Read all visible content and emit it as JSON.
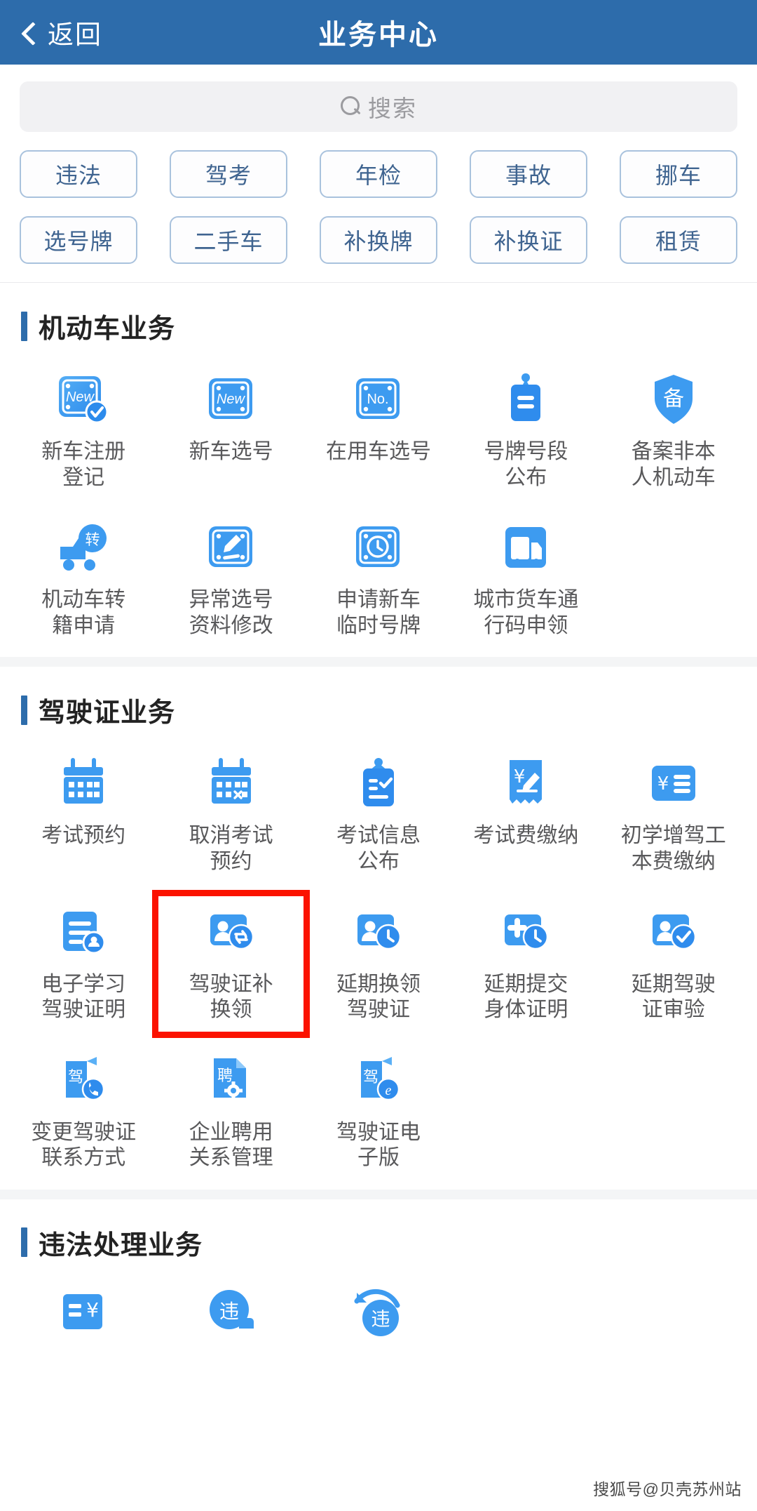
{
  "header": {
    "back_label": "返回",
    "title": "业务中心",
    "back_icon": "chevron-left-icon",
    "bg_color": "#2d6cab"
  },
  "search": {
    "placeholder": "搜索",
    "icon": "search-icon"
  },
  "quick_tags": {
    "row1": [
      "违法",
      "驾考",
      "年检",
      "事故",
      "挪车"
    ],
    "row2": [
      "选号牌",
      "二手车",
      "补换牌",
      "补换证",
      "租赁"
    ]
  },
  "sections": [
    {
      "title": "机动车业务",
      "items": [
        {
          "label": "新车注册\n登记",
          "icon": "plate-new-check-icon"
        },
        {
          "label": "新车选号",
          "icon": "plate-new-icon"
        },
        {
          "label": "在用车选号",
          "icon": "plate-no-icon"
        },
        {
          "label": "号牌号段\n公布",
          "icon": "tag-board-icon"
        },
        {
          "label": "备案非本\n人机动车",
          "icon": "shield-bei-icon"
        },
        {
          "label": "机动车转\n籍申请",
          "icon": "truck-zhuan-icon"
        },
        {
          "label": "异常选号\n资料修改",
          "icon": "plate-pencil-icon"
        },
        {
          "label": "申请新车\n临时号牌",
          "icon": "plate-clock-icon"
        },
        {
          "label": "城市货车通\n行码申领",
          "icon": "cargo-truck-icon"
        }
      ]
    },
    {
      "title": "驾驶证业务",
      "items": [
        {
          "label": "考试预约",
          "icon": "calendar-icon"
        },
        {
          "label": "取消考试\n预约",
          "icon": "calendar-cancel-icon"
        },
        {
          "label": "考试信息\n公布",
          "icon": "clipboard-check-icon"
        },
        {
          "label": "考试费缴纳",
          "icon": "receipt-yuan-pen-icon"
        },
        {
          "label": "初学增驾工\n本费缴纳",
          "icon": "yuan-list-icon"
        },
        {
          "label": "电子学习\n驾驶证明",
          "icon": "document-stamp-icon"
        },
        {
          "label": "驾驶证补\n换领",
          "icon": "id-refresh-icon",
          "highlighted": true
        },
        {
          "label": "延期换领\n驾驶证",
          "icon": "id-clock-icon"
        },
        {
          "label": "延期提交\n身体证明",
          "icon": "plus-clock-icon"
        },
        {
          "label": "延期驾驶\n证审验",
          "icon": "id-check-icon"
        },
        {
          "label": "变更驾驶证\n联系方式",
          "icon": "license-phone-icon"
        },
        {
          "label": "企业聘用\n关系管理",
          "icon": "pin-gear-icon"
        },
        {
          "label": "驾驶证电\n子版",
          "icon": "license-e-icon"
        }
      ]
    },
    {
      "title": "违法处理业务",
      "items": [
        {
          "label": "",
          "icon": "fine-yuan-icon"
        },
        {
          "label": "",
          "icon": "wei-balloon-icon"
        },
        {
          "label": "",
          "icon": "wei-arrow-icon"
        }
      ]
    }
  ],
  "highlight": {
    "color": "#fb1200",
    "target_label": "驾驶证补换领"
  },
  "watermark": "搜狐号@贝壳苏州站"
}
